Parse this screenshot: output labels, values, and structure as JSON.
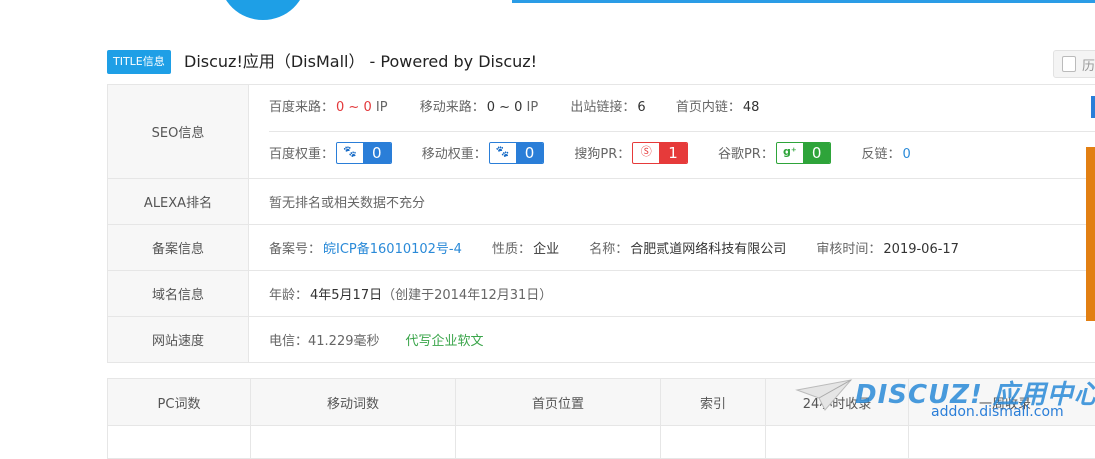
{
  "title_row": {
    "badge": "TITLE信息",
    "text": "Discuz!应用（DisMall） - Powered by Discuz!",
    "history_label": "历"
  },
  "seo": {
    "label": "SEO信息",
    "baidu_source_label": "百度来路：",
    "baidu_source_value": "0 ~ 0",
    "baidu_source_unit": "IP",
    "mobile_source_label": "移动来路：",
    "mobile_source_value": "0 ~ 0",
    "mobile_source_unit": "IP",
    "outbound_label": "出站链接：",
    "outbound_value": "6",
    "internal_label": "首页内链：",
    "internal_value": "48",
    "baidu_weight_label": "百度权重：",
    "baidu_weight_value": "0",
    "mobile_weight_label": "移动权重：",
    "mobile_weight_value": "0",
    "sogou_pr_label": "搜狗PR：",
    "sogou_pr_value": "1",
    "google_pr_label": "谷歌PR：",
    "google_pr_value": "0",
    "backlink_label": "反链：",
    "backlink_value": "0"
  },
  "alexa": {
    "label": "ALEXA排名",
    "text": "暂无排名或相关数据不充分"
  },
  "icp": {
    "label": "备案信息",
    "number_label": "备案号：",
    "number_value": "皖ICP备16010102号-4",
    "nature_label": "性质：",
    "nature_value": "企业",
    "name_label": "名称：",
    "name_value": "合肥贰道网络科技有限公司",
    "audit_label": "审核时间：",
    "audit_value": "2019-06-17"
  },
  "domain": {
    "label": "域名信息",
    "age_label": "年龄：",
    "age_value": "4年5月17日",
    "created": "（创建于2014年12月31日）"
  },
  "speed": {
    "label": "网站速度",
    "telecom": "电信：41.229毫秒",
    "ad_link": "代写企业软文"
  },
  "keywords_table": {
    "headers": [
      "PC词数",
      "移动词数",
      "首页位置",
      "索引",
      "24小时收录",
      "一周收录"
    ]
  },
  "watermark": {
    "text": "DISCUZ! 应用中心",
    "sub": "addon.dismall.com"
  },
  "colors": {
    "accent_blue": "#1e9fe6",
    "baidu_blue": "#2a7ed8",
    "sogou_red": "#e63a3a",
    "google_green": "#2ea43a",
    "side_orange": "#e27f12"
  },
  "icons": {
    "baidu": "paw-icon",
    "sogou": "sogou-s-icon",
    "google": "google-plus-icon",
    "history": "history-icon"
  }
}
